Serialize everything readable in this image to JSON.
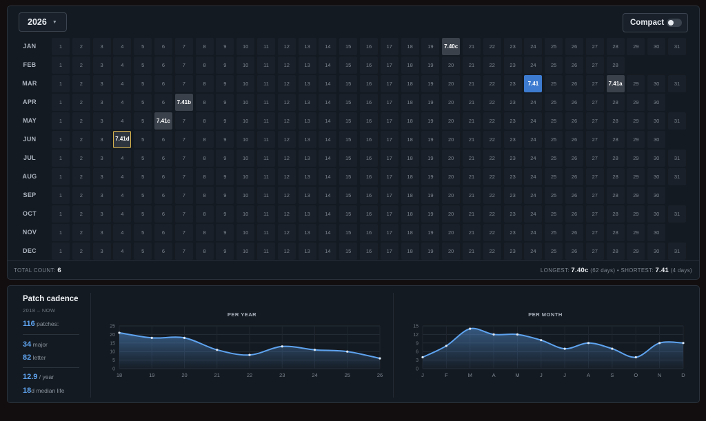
{
  "header": {
    "year": "2026",
    "compact_label": "Compact",
    "compact_on": false
  },
  "calendar": {
    "months": [
      {
        "label": "JAN",
        "days": 31
      },
      {
        "label": "FEB",
        "days": 28
      },
      {
        "label": "MAR",
        "days": 31
      },
      {
        "label": "APR",
        "days": 30
      },
      {
        "label": "MAY",
        "days": 31
      },
      {
        "label": "JUN",
        "days": 30
      },
      {
        "label": "JUL",
        "days": 31
      },
      {
        "label": "AUG",
        "days": 31
      },
      {
        "label": "SEP",
        "days": 30
      },
      {
        "label": "OCT",
        "days": 31
      },
      {
        "label": "NOV",
        "days": 30
      },
      {
        "label": "DEC",
        "days": 31
      }
    ],
    "patches": [
      {
        "month": 0,
        "day": 20,
        "label": "7.40c",
        "style": "patch"
      },
      {
        "month": 2,
        "day": 24,
        "label": "7.41",
        "style": "blue"
      },
      {
        "month": 2,
        "day": 28,
        "label": "7.41a",
        "style": "patch"
      },
      {
        "month": 3,
        "day": 7,
        "label": "7.41b",
        "style": "patch"
      },
      {
        "month": 4,
        "day": 6,
        "label": "7.41c",
        "style": "patch"
      },
      {
        "month": 5,
        "day": 4,
        "label": "7.41d",
        "style": "current"
      }
    ]
  },
  "footer": {
    "total_label": "TOTAL COUNT:",
    "total_value": "6",
    "longest_label": "LONGEST:",
    "longest_value": "7.40c",
    "longest_sub": "(62 days)",
    "separator": "•",
    "shortest_label": "SHORTEST:",
    "shortest_value": "7.41",
    "shortest_sub": "(4 days)"
  },
  "stats": {
    "title": "Patch cadence",
    "range": "2018 – NOW",
    "patches_value": "116",
    "patches_label": "patches:",
    "major_value": "34",
    "major_label": "major",
    "letter_value": "82",
    "letter_label": "letter",
    "per_year_value": "12.9",
    "per_year_label": "/ year",
    "median_value": "18",
    "median_label": "d median life"
  },
  "accent_color": "#5ea3ef",
  "chart_data": [
    {
      "type": "area",
      "title": "PER YEAR",
      "x": [
        "18",
        "19",
        "20",
        "21",
        "22",
        "23",
        "24",
        "25",
        "26"
      ],
      "values": [
        21,
        18,
        18,
        11,
        8,
        13,
        11,
        10,
        6
      ],
      "ylim": [
        0,
        25
      ],
      "yticks": [
        0,
        5,
        10,
        15,
        20,
        25
      ],
      "grid": true,
      "color": "#5ea3ef"
    },
    {
      "type": "area",
      "title": "PER MONTH",
      "x": [
        "J",
        "F",
        "M",
        "A",
        "M",
        "J",
        "J",
        "A",
        "S",
        "O",
        "N",
        "D"
      ],
      "values": [
        4,
        8,
        14,
        12,
        12,
        10,
        7,
        9,
        7,
        4,
        9,
        9
      ],
      "ylim": [
        0,
        15
      ],
      "yticks": [
        0,
        3,
        6,
        9,
        12,
        15
      ],
      "grid": true,
      "color": "#5ea3ef"
    }
  ]
}
